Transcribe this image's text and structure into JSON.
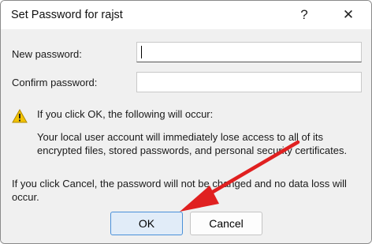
{
  "window": {
    "title": "Set Password for rajst",
    "help_glyph": "?",
    "close_glyph": "✕"
  },
  "form": {
    "new_password_label": "New password:",
    "new_password_value": "",
    "confirm_password_label": "Confirm password:",
    "confirm_password_value": ""
  },
  "warning": {
    "icon": "warning-triangle-icon",
    "heading": "If you click OK, the following will occur:",
    "body": "Your local user account will immediately lose access to all of its encrypted files, stored passwords, and personal security certificates."
  },
  "cancel_note": "If you click Cancel, the password will not be changed and no data loss will occur.",
  "buttons": {
    "ok": "OK",
    "cancel": "Cancel"
  },
  "annotation": {
    "arrow_color": "#e02020"
  },
  "colors": {
    "ok_accent": "#4a90d9",
    "warning": "#f2c200"
  }
}
